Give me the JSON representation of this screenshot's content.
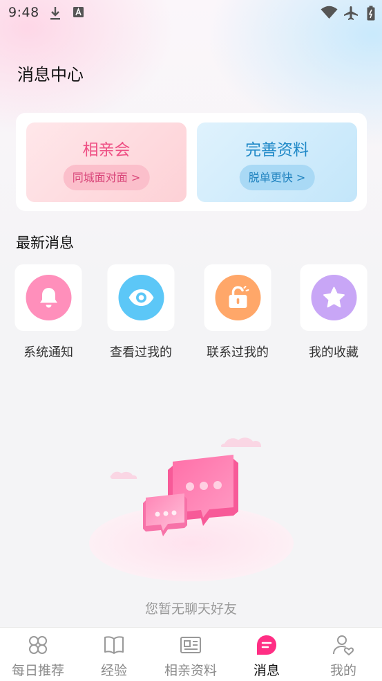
{
  "status_bar": {
    "time": "9:48",
    "icons": [
      "download-icon",
      "a-badge-icon",
      "wifi-icon",
      "airplane-icon",
      "battery-icon"
    ]
  },
  "header": {
    "title": "消息中心"
  },
  "promo": {
    "left": {
      "title": "相亲会",
      "button": "同城面对面 >",
      "color": "#ee4f84"
    },
    "right": {
      "title": "完善资料",
      "button": "脱单更快 >",
      "color": "#1e88c7"
    }
  },
  "section": {
    "title": "最新消息"
  },
  "quick_actions": [
    {
      "label": "系统通知",
      "icon": "bell-icon",
      "color": "#ff8fbb"
    },
    {
      "label": "查看过我的",
      "icon": "eye-icon",
      "color": "#5cc7f7"
    },
    {
      "label": "联系过我的",
      "icon": "unlock-icon",
      "color": "#ffa769"
    },
    {
      "label": "我的收藏",
      "icon": "star-icon",
      "color": "#c8a6f6"
    }
  ],
  "empty_state": {
    "text": "您暂无聊天好友",
    "icon": "chat-bubbles-illustration"
  },
  "bottom_nav": {
    "active_index": 3,
    "items": [
      {
        "label": "每日推荐",
        "icon": "clover-icon"
      },
      {
        "label": "经验",
        "icon": "book-icon"
      },
      {
        "label": "相亲资料",
        "icon": "profile-card-icon"
      },
      {
        "label": "消息",
        "icon": "message-icon"
      },
      {
        "label": "我的",
        "icon": "user-heart-icon"
      }
    ]
  }
}
